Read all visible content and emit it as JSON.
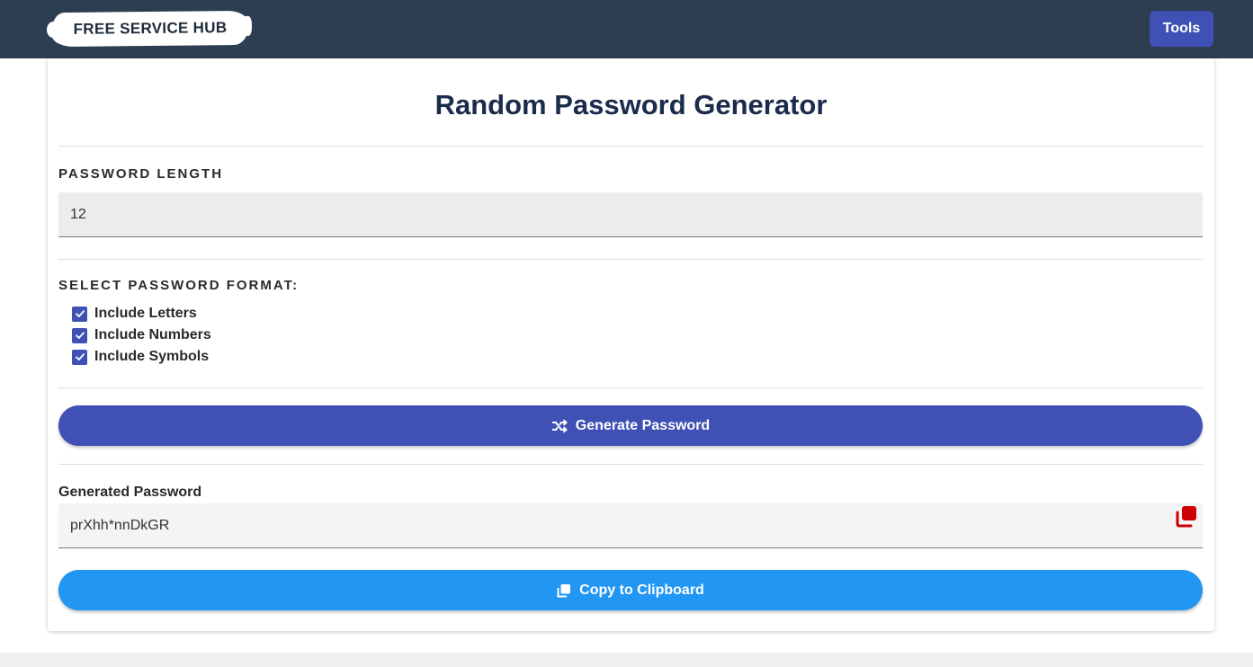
{
  "header": {
    "logo_text": "FREE SERVICE HUB",
    "tools_label": "Tools"
  },
  "main": {
    "title": "Random Password Generator",
    "length_label": "PASSWORD LENGTH",
    "length_value": "12",
    "format_label": "SELECT PASSWORD FORMAT:",
    "options": [
      {
        "label": "Include Letters",
        "checked": true
      },
      {
        "label": "Include Numbers",
        "checked": true
      },
      {
        "label": "Include Symbols",
        "checked": true
      }
    ],
    "generate_label": "Generate Password",
    "generated_label": "Generated Password",
    "generated_value": "prXhh*nnDkGR",
    "copy_label": "Copy to Clipboard"
  },
  "colors": {
    "navbar": "#2c3e50",
    "primary": "#3f51b5",
    "copy_button": "#2196f3",
    "copy_icon": "#cc0000"
  },
  "icons": {
    "generate": "shuffle-icon",
    "copy_field": "copy-icon",
    "copy_button": "copy-icon"
  }
}
